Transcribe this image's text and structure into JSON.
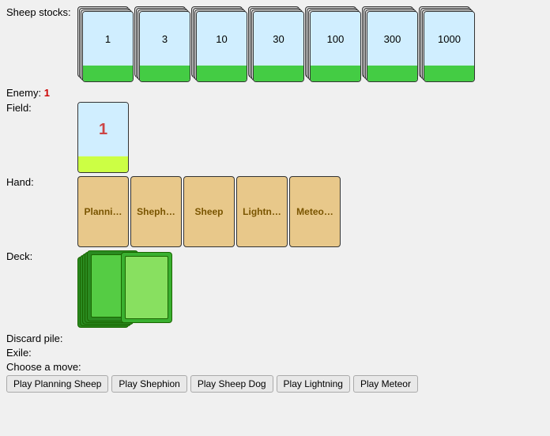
{
  "sheepStocks": {
    "label": "Sheep stocks:",
    "cards": [
      {
        "value": "1"
      },
      {
        "value": "3"
      },
      {
        "value": "10"
      },
      {
        "value": "30"
      },
      {
        "value": "100"
      },
      {
        "value": "300"
      },
      {
        "value": "1000"
      }
    ]
  },
  "enemy": {
    "label": "Enemy:",
    "value": "1"
  },
  "field": {
    "label": "Field:",
    "cardValue": "1"
  },
  "hand": {
    "label": "Hand:",
    "cards": [
      {
        "name": "Planni…"
      },
      {
        "name": "Sheph…"
      },
      {
        "name": "Sheep"
      },
      {
        "name": "Lightn…"
      },
      {
        "name": "Meteo…"
      }
    ]
  },
  "deck": {
    "label": "Deck:"
  },
  "discardPile": {
    "label": "Discard pile:"
  },
  "exile": {
    "label": "Exile:"
  },
  "chooseMove": {
    "label": "Choose a move:"
  },
  "buttons": [
    {
      "label": "Play Planning Sheep",
      "name": "play-planning-sheep-button"
    },
    {
      "label": "Play Shephion",
      "name": "play-shephion-button"
    },
    {
      "label": "Play Sheep Dog",
      "name": "play-sheep-dog-button"
    },
    {
      "label": "Play Lightning",
      "name": "play-lightning-button"
    },
    {
      "label": "Play Meteor",
      "name": "play-meteor-button"
    }
  ]
}
